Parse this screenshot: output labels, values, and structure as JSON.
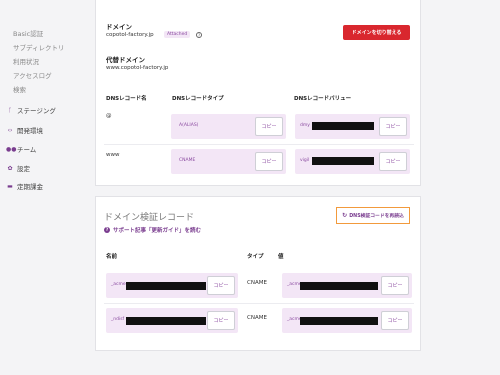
{
  "sidebar": {
    "sub_items": [
      "Basic認証",
      "サブディレクトリ",
      "利用状況",
      "アクセスログ",
      "検索"
    ],
    "nav_items": [
      {
        "label": "ステージング",
        "icon": "staging-icon"
      },
      {
        "label": "開発環境",
        "icon": "code-icon"
      },
      {
        "label": "チーム",
        "icon": "team-icon"
      },
      {
        "label": "設定",
        "icon": "gear-icon"
      },
      {
        "label": "定期課金",
        "icon": "billing-icon"
      }
    ]
  },
  "domain_section": {
    "domain_label": "ドメイン",
    "domain_value": "copotol-factory.jp",
    "attached_badge": "Attached",
    "switch_button": "ドメインを切り替える",
    "alias_label": "代替ドメイン",
    "alias_value": "www.copotol-factory.jp",
    "dns_headers": {
      "name": "DNSレコード名",
      "type": "DNSレコードタイプ",
      "value": "DNSレコードバリュー"
    },
    "dns_rows": [
      {
        "name": "@",
        "type": "A(ALIAS)",
        "value_prefix": "dmy",
        "copy": "コピー"
      },
      {
        "name": "www",
        "type": "CNAME",
        "value_prefix": "vigil",
        "copy": "コピー"
      }
    ]
  },
  "verify_section": {
    "title": "ドメイン検証レコード",
    "help_link": "サポート記事「更新ガイド」を読む",
    "recheck_button": "DNS検証コードを再読込",
    "headers": {
      "name": "名前",
      "type": "タイプ",
      "value": "値"
    },
    "rows": [
      {
        "name_prefix": "_acme",
        "type": "CNAME",
        "value_prefix": "_acme",
        "copy": "コピー"
      },
      {
        "name_prefix": "_ndisf",
        "type": "CNAME",
        "value_prefix": "_acme",
        "copy": "コピー"
      }
    ]
  },
  "colors": {
    "accent": "#7a3d8f",
    "danger": "#d9272e",
    "highlight": "#f29a3c",
    "pill": "#f3e6f6"
  }
}
